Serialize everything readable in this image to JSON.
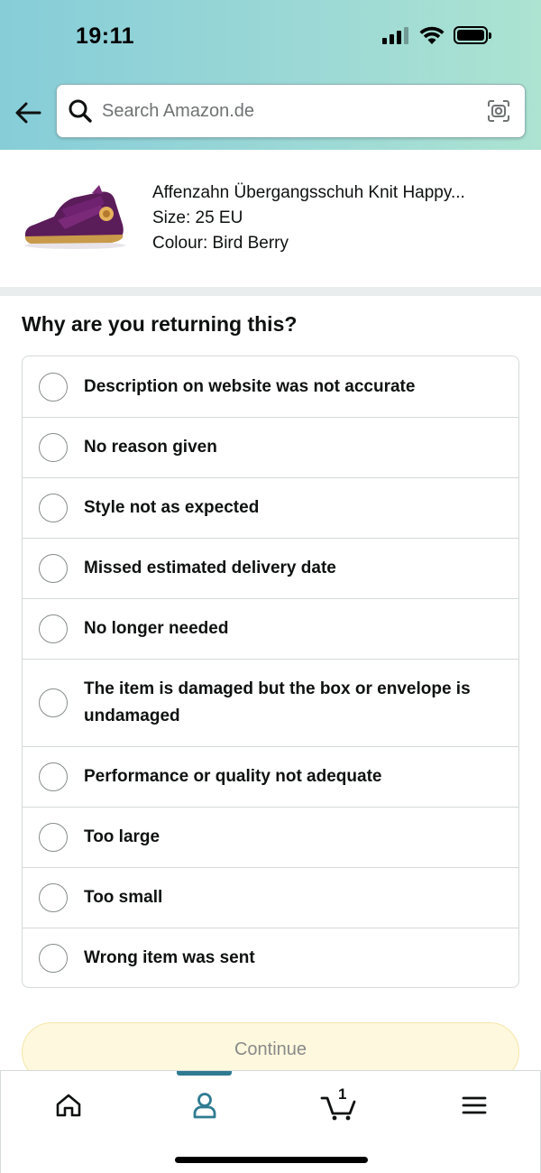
{
  "status_bar": {
    "time": "19:11"
  },
  "search": {
    "placeholder": "Search Amazon.de"
  },
  "product": {
    "title": "Affenzahn Übergangsschuh Knit Happy...",
    "size": "Size: 25 EU",
    "colour": "Colour: Bird Berry"
  },
  "form": {
    "question": "Why are you returning this?",
    "reasons": [
      "Description on website was not accurate",
      "No reason given",
      "Style not as expected",
      "Missed estimated delivery date",
      "No longer needed",
      "The item is damaged but the box or envelope is undamaged",
      "Performance or quality not adequate",
      "Too large",
      "Too small",
      "Wrong item was sent"
    ],
    "continue_label": "Continue"
  },
  "bottom_nav": {
    "cart_count": "1",
    "active_tab": "account"
  },
  "colors": {
    "active_tab": "#2f7b91",
    "continue_bg": "#fef8de",
    "header_gradient_start": "#86cdd8",
    "header_gradient_end": "#ace3d1"
  },
  "icons": [
    "back-arrow-icon",
    "search-icon",
    "camera-icon",
    "home-icon",
    "person-icon",
    "cart-icon",
    "menu-icon"
  ]
}
